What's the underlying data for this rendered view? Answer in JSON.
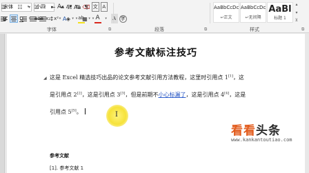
{
  "ribbon": {
    "font_name": "宋体",
    "font_size": "小四",
    "grow_font_label": "A",
    "shrink_font_label": "A",
    "case_label": "Aa",
    "clear_format_label": "⌫",
    "wen_label": "文",
    "bold_label": "B",
    "italic_label": "I",
    "underline_label": "U",
    "strike_label": "abc",
    "sub_label": "x₂",
    "sup_label": "x²",
    "highlight_label": "ab",
    "font_color_label": "A",
    "font_group_label": "字体",
    "paragraph_group_label": "段落",
    "styles_group_label": "样式",
    "styles": [
      {
        "sample": "AaBbCcDc",
        "name": "↵正文"
      },
      {
        "sample": "AaBbCcDc",
        "name": "↵无间隔"
      },
      {
        "sample": "AaBl",
        "name": "标题 1"
      }
    ],
    "accent_red": "#d9261c",
    "accent_yellow": "#f3e01a"
  },
  "document": {
    "title": "参考文献标注技巧",
    "line1_a": "这是 Excel 精选技巧出品的论文参考文献引用方法教程，这里时引用点 1",
    "line1_sup": "[1]",
    "line1_b": "，这",
    "line2_a": "是引用点 2",
    "line2_sup1": "[2]",
    "line2_b": "，这是引用点 3",
    "line2_sup2": "[3]",
    "line2_c": "，但是前期不",
    "line2_spell": "小心标漏了",
    "line2_d": "，这是引用点 4",
    "line2_sup3": "[4]",
    "line2_e": "，这是",
    "line3_a": "引用点 5",
    "line3_sup": "[5]",
    "line3_b": "。",
    "cursor_glyph": "I",
    "ref_heading": "参考文献",
    "ref_item": "[1]. 参考文献 1"
  },
  "watermark": {
    "cn_a": "看看",
    "cn_b": "头条",
    "url": "www.kankantoutiao.com"
  }
}
